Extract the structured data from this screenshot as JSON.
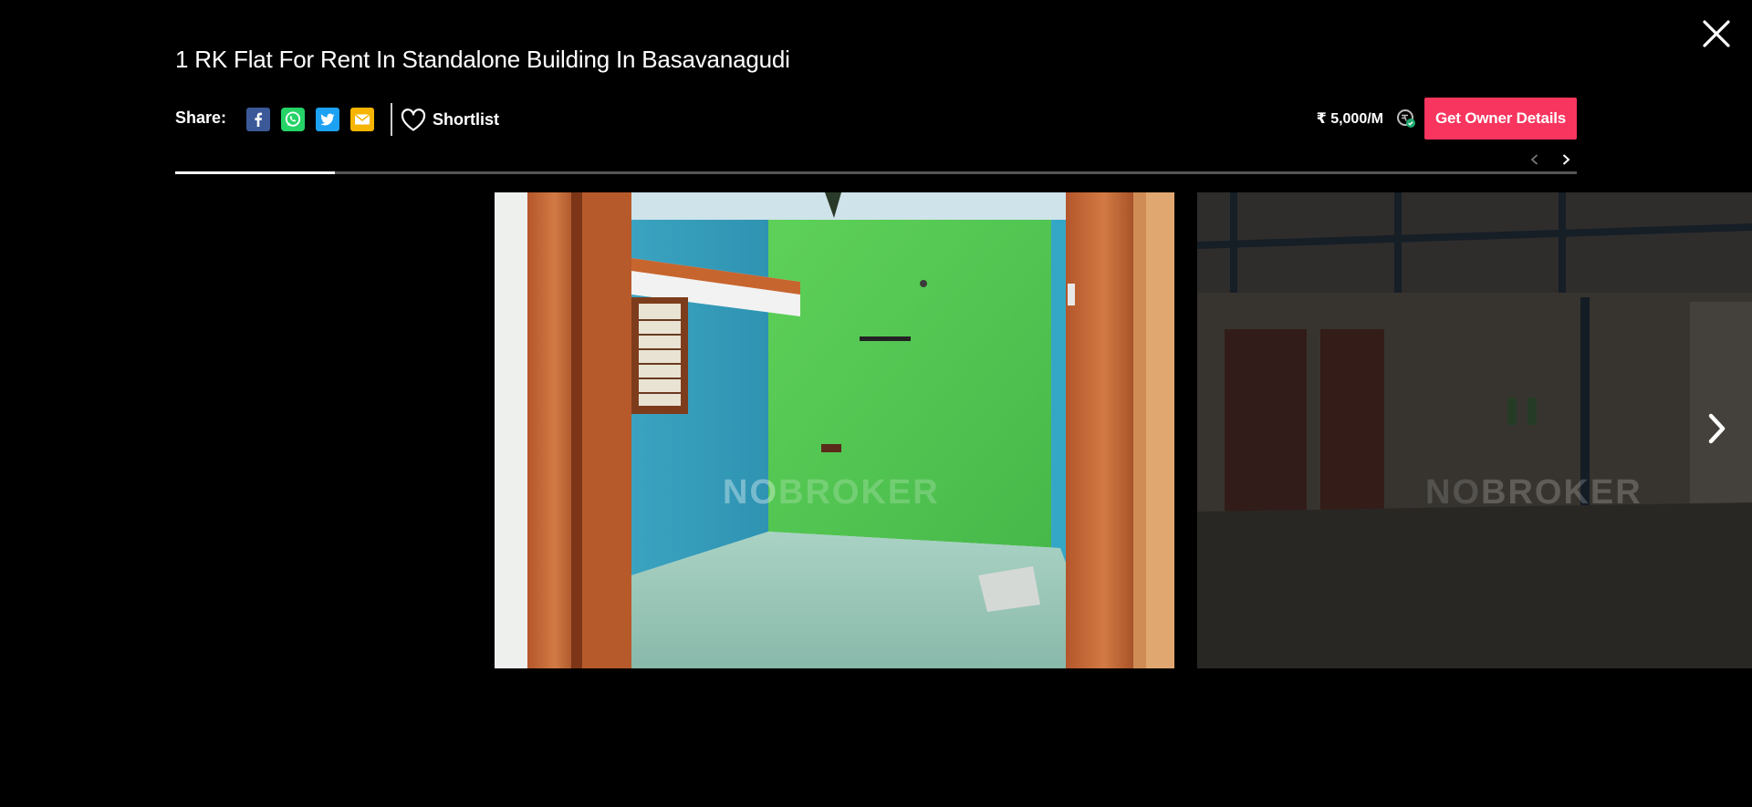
{
  "listing": {
    "title": "1 RK Flat For Rent In Standalone Building In Basavanagudi"
  },
  "share": {
    "label": "Share:",
    "icons": [
      "facebook-icon",
      "whatsapp-icon",
      "twitter-icon",
      "email-icon"
    ]
  },
  "shortlist": {
    "label": "Shortlist"
  },
  "pricing": {
    "rent": "₹ 5,000/M",
    "cta_label": "Get Owner Details"
  },
  "gallery": {
    "progress_fraction": 0.114,
    "watermark": "NOBROKER",
    "watermark_parts": [
      "NO",
      "BROKER"
    ]
  },
  "colors": {
    "background": "#000000",
    "cta": "#f7355e",
    "facebook": "#3b5998",
    "whatsapp": "#25d366",
    "twitter": "#1da1f2",
    "email": "#f5b400"
  }
}
